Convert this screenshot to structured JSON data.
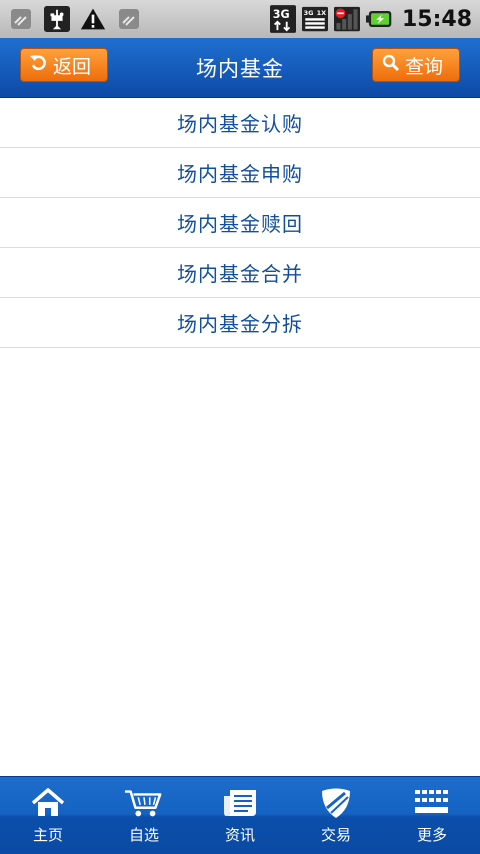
{
  "status_bar": {
    "icons": [
      "satellite-icon",
      "usb-icon",
      "warning-icon",
      "satellite-icon",
      "3g-data-icon",
      "3g-1x-icon",
      "signal-icon",
      "battery-charging-icon"
    ],
    "time": "15:48",
    "labels": {
      "data_3g": "3G",
      "net_3g": "3G",
      "net_1x": "1X"
    }
  },
  "header": {
    "title": "场内基金",
    "back_label": "返回",
    "query_label": "查询"
  },
  "menu": {
    "items": [
      {
        "label": "场内基金认购"
      },
      {
        "label": "场内基金申购"
      },
      {
        "label": "场内基金赎回"
      },
      {
        "label": "场内基金合并"
      },
      {
        "label": "场内基金分拆"
      }
    ]
  },
  "bottom_nav": {
    "items": [
      {
        "label": "主页",
        "icon": "home-icon"
      },
      {
        "label": "自选",
        "icon": "cart-icon"
      },
      {
        "label": "资讯",
        "icon": "news-icon"
      },
      {
        "label": "交易",
        "icon": "shield-icon"
      },
      {
        "label": "更多",
        "icon": "grid-icon"
      }
    ]
  },
  "colors": {
    "header_blue": "#1660c0",
    "button_orange": "#f5841f",
    "menu_text": "#124e9e"
  }
}
